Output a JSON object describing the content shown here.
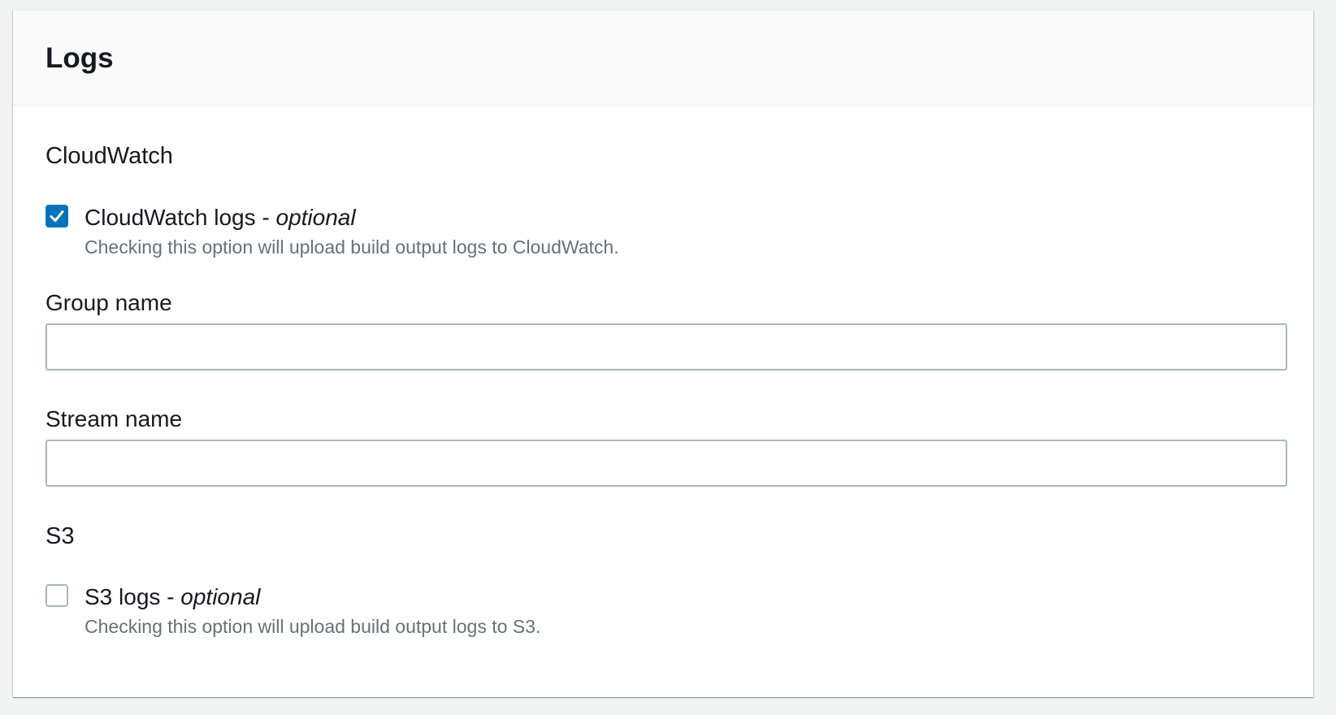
{
  "panel": {
    "title": "Logs"
  },
  "cloudwatch": {
    "section_title": "CloudWatch",
    "checkbox": {
      "label": "CloudWatch logs - ",
      "optional": "optional",
      "description": "Checking this option will upload build output logs to CloudWatch.",
      "checked": true
    },
    "group_name": {
      "label": "Group name",
      "value": ""
    },
    "stream_name": {
      "label": "Stream name",
      "value": ""
    }
  },
  "s3": {
    "section_title": "S3",
    "checkbox": {
      "label": "S3 logs - ",
      "optional": "optional",
      "description": "Checking this option will upload build output logs to S3.",
      "checked": false
    }
  },
  "colors": {
    "accent": "#0073bb",
    "border": "#aab7b8",
    "description_text": "#687078",
    "header_bg": "#fafafa",
    "page_bg": "#f2f3f3"
  }
}
